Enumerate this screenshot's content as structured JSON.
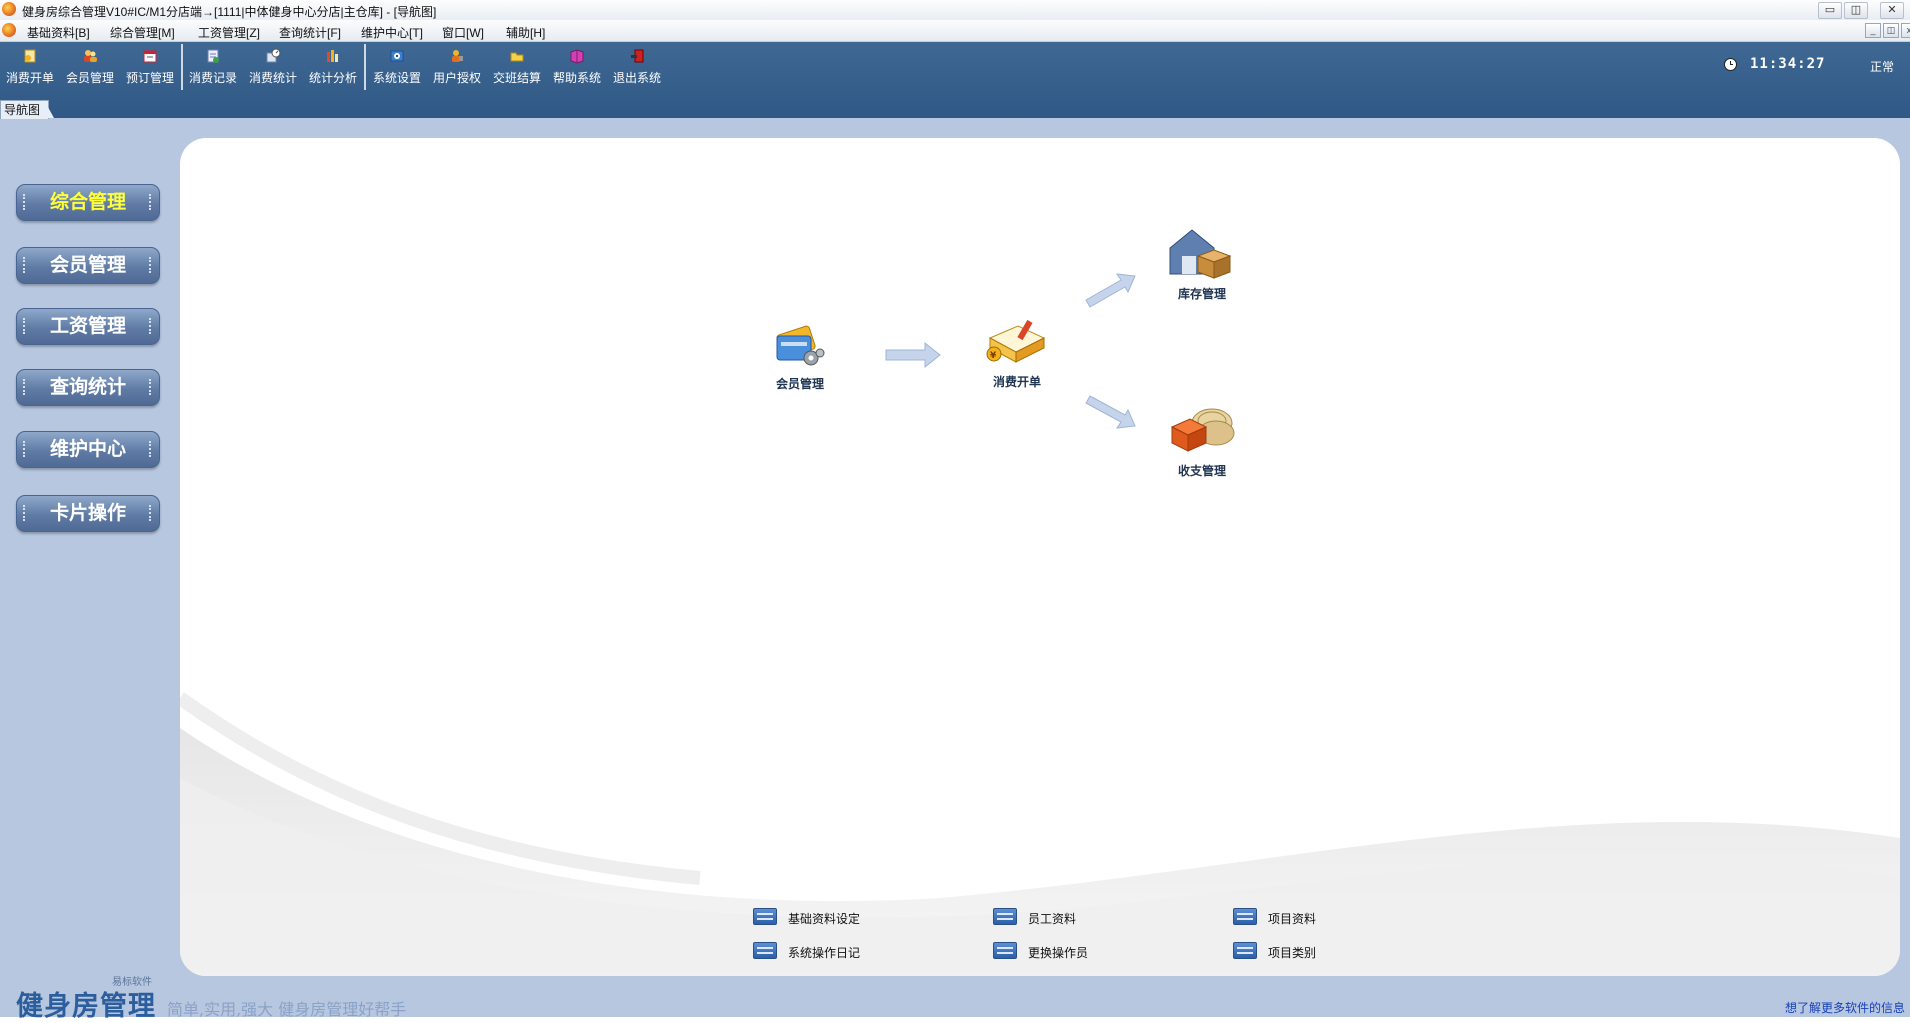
{
  "window": {
    "title": "健身房综合管理V10#IC/M1分店端→[1111|中体健身中心分店|主仓库] - [导航图]",
    "controls": [
      "▭",
      "◫",
      "✕"
    ]
  },
  "menubar": {
    "items": [
      "基础资料[B]",
      "综合管理[M]",
      "工资管理[Z]",
      "查询统计[F]",
      "维护中心[T]",
      "窗口[W]",
      "辅助[H]"
    ],
    "mdi_controls": [
      "_",
      "◫",
      "x"
    ]
  },
  "toolbar": {
    "buttons": [
      {
        "label": "消费开单",
        "icon": "bill-icon"
      },
      {
        "label": "会员管理",
        "icon": "members-icon"
      },
      {
        "label": "预订管理",
        "icon": "booking-icon"
      },
      {
        "label": "消费记录",
        "icon": "records-icon"
      },
      {
        "label": "消费统计",
        "icon": "consumption-stats-icon"
      },
      {
        "label": "统计分析",
        "icon": "analysis-icon"
      },
      {
        "label": "系统设置",
        "icon": "settings-icon"
      },
      {
        "label": "用户授权",
        "icon": "user-auth-icon"
      },
      {
        "label": "交班结算",
        "icon": "shift-settlement-icon"
      },
      {
        "label": "帮助系统",
        "icon": "help-icon"
      },
      {
        "label": "退出系统",
        "icon": "exit-icon"
      }
    ],
    "time": "11:34:27",
    "status": "正常"
  },
  "tab": {
    "label": "导航图"
  },
  "sidebar": {
    "items": [
      "综合管理",
      "会员管理",
      "工资管理",
      "查询统计",
      "维护中心",
      "卡片操作"
    ],
    "active_index": 0
  },
  "flow": {
    "nodes": {
      "member": "会员管理",
      "bill": "消费开单",
      "inventory": "库存管理",
      "finance": "收支管理"
    }
  },
  "quick_links": [
    "基础资料设定",
    "员工资料",
    "项目资料",
    "系统操作日记",
    "更换操作员",
    "项目类别"
  ],
  "footer": {
    "brand_small": "易标软件",
    "brand": "健身房管理",
    "slogan": "简单,实用,强大   健身房管理好帮手",
    "more_link": "想了解更多软件的信息"
  },
  "colors": {
    "toolbar": "#33608e",
    "background": "#b7c7e0",
    "sidebar_active_text": "#ffff3a",
    "link": "#1740b8"
  }
}
